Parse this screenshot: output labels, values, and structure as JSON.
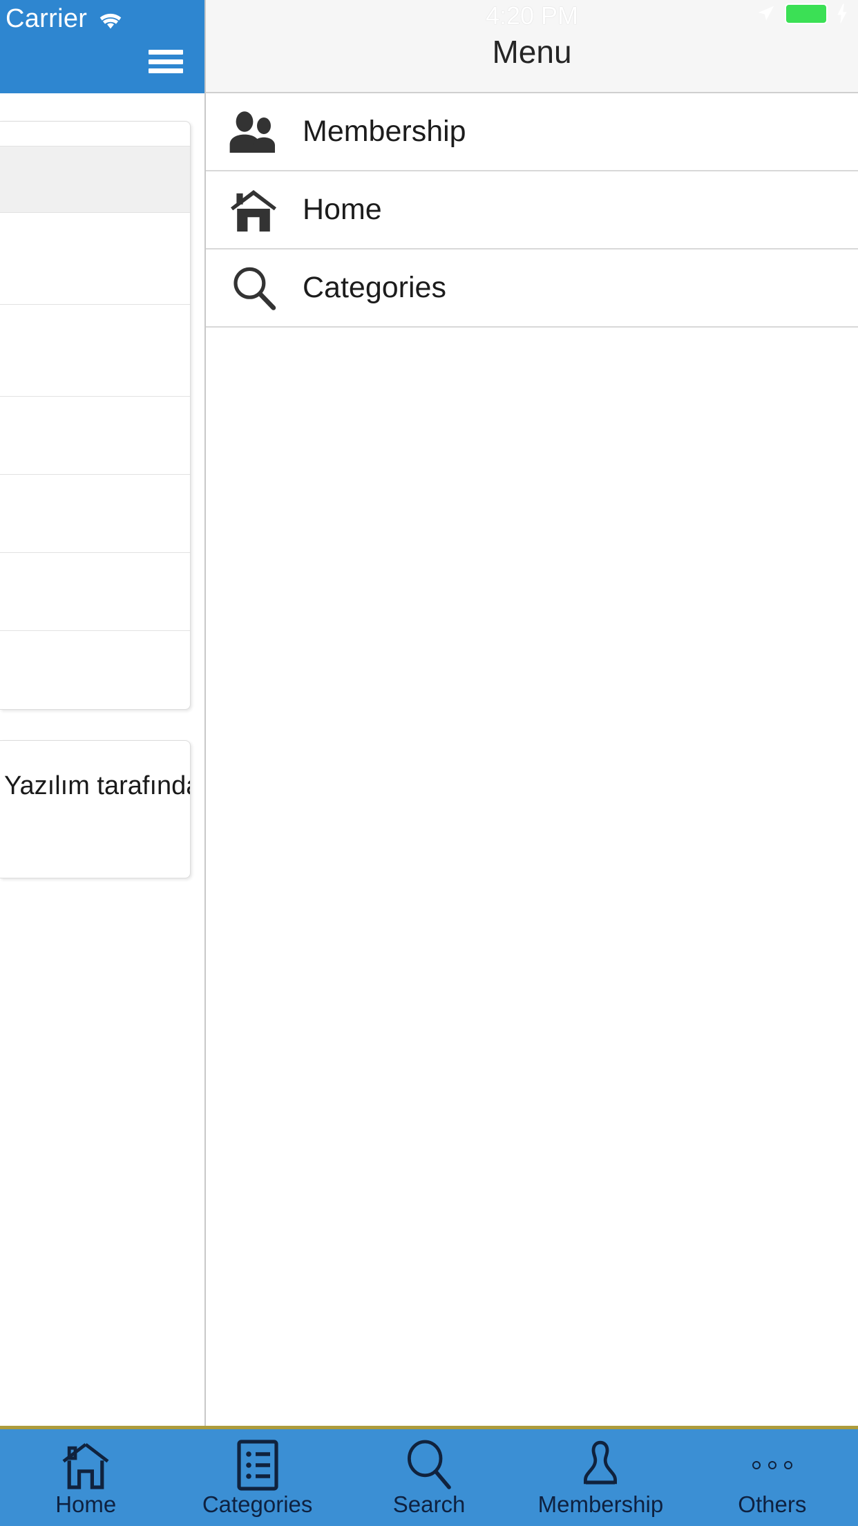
{
  "left_app": {
    "status_bar": {
      "carrier": "Carrier",
      "wifi_icon": "wifi-icon"
    },
    "menu_button_icon": "hamburger-menu-icon",
    "rows": [
      {
        "id": "row-1",
        "label": "",
        "shaded": false
      },
      {
        "id": "row-2",
        "label": "",
        "shaded": true
      },
      {
        "id": "row-3",
        "label": "",
        "shaded": false
      },
      {
        "id": "row-4",
        "label": "",
        "shaded": false
      },
      {
        "id": "row-5",
        "label": "",
        "shaded": false
      },
      {
        "id": "row-6",
        "label": "",
        "shaded": false
      },
      {
        "id": "row-7",
        "label": "",
        "shaded": false
      },
      {
        "id": "row-8",
        "label": "",
        "shaded": false
      }
    ],
    "footer_card": {
      "text": "Yazılım tarafından"
    }
  },
  "drawer": {
    "status_bar": {
      "time": "4:20 PM",
      "location_icon": "location-arrow-icon",
      "battery_icon": "battery-full-icon",
      "battery_color": "#3BE055",
      "charging_icon": "lightning-bolt-icon"
    },
    "title": "Menu",
    "items": [
      {
        "label": "Membership",
        "icon": "people-icon"
      },
      {
        "label": "Home",
        "icon": "house-icon"
      },
      {
        "label": "Categories",
        "icon": "magnifier-icon"
      }
    ]
  },
  "tabbar": {
    "accent_color": "#3B8FD4",
    "border_color": "#AD9C3C",
    "icon_color": "#10223D",
    "tabs": [
      {
        "label": "Home",
        "icon": "house-outline-icon"
      },
      {
        "label": "Categories",
        "icon": "list-outline-icon"
      },
      {
        "label": "Search",
        "icon": "magnifier-outline-icon"
      },
      {
        "label": "Membership",
        "icon": "person-outline-icon"
      },
      {
        "label": "Others",
        "icon": "ellipsis-icon"
      }
    ]
  }
}
